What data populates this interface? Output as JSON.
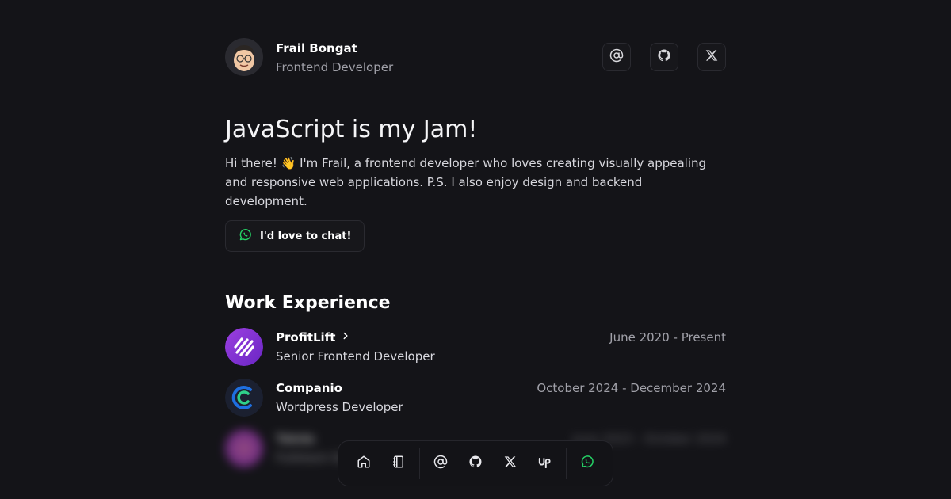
{
  "profile": {
    "name": "Frail Bongat",
    "role": "Frontend Developer",
    "avatar_icon": "memoji-avatar"
  },
  "social": [
    {
      "icon": "at-icon",
      "label": "Email"
    },
    {
      "icon": "github-icon",
      "label": "GitHub"
    },
    {
      "icon": "x-icon",
      "label": "X"
    }
  ],
  "hero": {
    "title": "JavaScript is my Jam!",
    "text": "Hi there! 👋  I'm Frail, a frontend developer who loves creating visually appealing and responsive web applications. P.S. I also enjoy design and backend development.",
    "cta_label": "I'd love to chat!",
    "cta_icon": "whatsapp-icon"
  },
  "work": {
    "title": "Work Experience",
    "jobs": [
      {
        "company": "ProfitLift",
        "position": "Senior Frontend Developer",
        "dates": "June 2020 - Present",
        "has_link": true
      },
      {
        "company": "Companio",
        "position": "Wordpress Developer",
        "dates": "October 2024 - December 2024"
      },
      {
        "company": "Takda",
        "position": "Fullstack Developer",
        "dates": "June 2023 - October 2024"
      }
    ]
  },
  "dock": [
    "home-icon",
    "notebook-icon",
    "at-icon",
    "github-icon",
    "x-icon",
    "upwork-icon",
    "whatsapp-icon"
  ],
  "colors": {
    "background": "#141418",
    "accent_green": "#25d366",
    "profitlift_purple": "#7b2fcf",
    "companio_blue": "#1e6fe0"
  }
}
